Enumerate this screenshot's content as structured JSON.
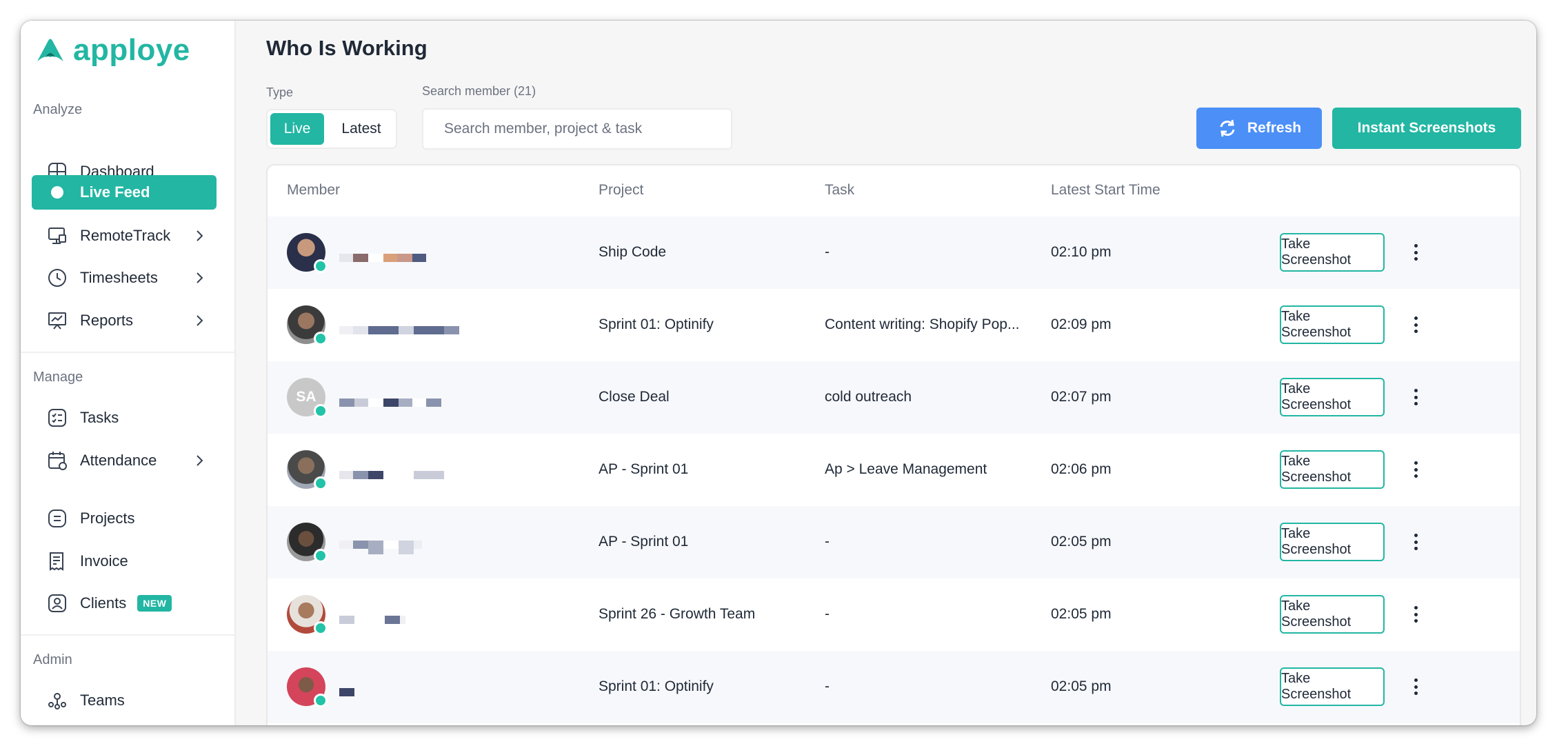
{
  "app": {
    "logo_text": "apploye",
    "brand_color": "#22b6a3"
  },
  "sidebar": {
    "sections": {
      "analyze": "Analyze",
      "manage": "Manage",
      "admin": "Admin"
    },
    "items": [
      {
        "label": "Dashboard",
        "icon": "dashboard-icon"
      },
      {
        "label": "Live Feed",
        "icon": "live-dot-icon",
        "active": true
      },
      {
        "label": "RemoteTrack",
        "icon": "monitor-icon",
        "expandable": true
      },
      {
        "label": "Timesheets",
        "icon": "clock-icon",
        "expandable": true
      },
      {
        "label": "Reports",
        "icon": "chart-board-icon",
        "expandable": true
      },
      {
        "label": "Tasks",
        "icon": "task-list-icon"
      },
      {
        "label": "Attendance",
        "icon": "calendar-icon",
        "expandable": true
      },
      {
        "label": "Projects",
        "icon": "project-icon"
      },
      {
        "label": "Invoice",
        "icon": "invoice-icon"
      },
      {
        "label": "Clients",
        "icon": "client-icon",
        "badge": "NEW"
      },
      {
        "label": "Teams",
        "icon": "teams-icon"
      }
    ]
  },
  "main": {
    "title": "Who Is Working",
    "type_label": "Type",
    "type_options": [
      "Live",
      "Latest"
    ],
    "type_selected": "Live",
    "search_label": "Search member (21)",
    "search_placeholder": "Search member, project & task",
    "refresh_label": "Refresh",
    "instant_label": "Instant Screenshots",
    "refresh_color": "#4b8ff7"
  },
  "table": {
    "headers": [
      "Member",
      "Project",
      "Task",
      "Latest Start Time"
    ],
    "action_label": "Take Screenshot",
    "rows": [
      {
        "avatar": "photo",
        "project": "Ship Code",
        "task": "-",
        "time": "02:10 pm"
      },
      {
        "avatar": "photo",
        "project": "Sprint 01: Optinify",
        "task": "Content writing: Shopify Pop...",
        "time": "02:09 pm"
      },
      {
        "avatar": "initials",
        "initials": "SA",
        "project": "Close Deal",
        "task": "cold outreach",
        "time": "02:07 pm"
      },
      {
        "avatar": "photo",
        "project": "AP - Sprint 01",
        "task": "Ap > Leave Management",
        "time": "02:06 pm"
      },
      {
        "avatar": "photo",
        "project": "AP - Sprint 01",
        "task": "-",
        "time": "02:05 pm"
      },
      {
        "avatar": "photo",
        "project": "Sprint 26 - Growth Team",
        "task": "-",
        "time": "02:05 pm"
      },
      {
        "avatar": "photo",
        "project": "Sprint 01: Optinify",
        "task": "-",
        "time": "02:05 pm"
      }
    ]
  }
}
